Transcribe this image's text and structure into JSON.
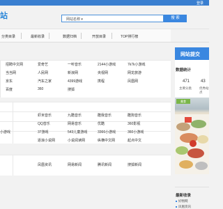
{
  "header": {
    "logo_fragment": "站",
    "login": "登录"
  },
  "search": {
    "category": "网站名称 ▾",
    "placeholder": "",
    "button": "搜 索"
  },
  "nav": {
    "items": [
      "分类目录",
      "最新收录",
      "数据归档",
      "开放目录",
      "TOP排行榜"
    ]
  },
  "links_block1": {
    "rows": [
      [
        "招聘中文网",
        "爱奇艺",
        "一听音乐",
        "2144小游戏",
        "7k7k小游戏"
      ],
      [
        "当当网",
        "人民网",
        "新浪网",
        "央视网",
        "网龙旅游"
      ],
      [
        "京东",
        "汽车之家",
        "4399游戏",
        "携程",
        "凤凰网"
      ],
      [
        "百度",
        "360",
        "搜狐",
        "",
        ""
      ]
    ]
  },
  "links_block2": {
    "rows": [
      [
        "",
        "虾米音乐",
        "九酷音乐",
        "酷我音乐",
        "酷狗音乐"
      ],
      [
        "",
        "QQ音乐",
        "网易音乐",
        "优酷",
        "360影视"
      ],
      [
        "小游戏",
        "37游戏",
        "543儿童游戏",
        "3366小游戏",
        "360小游戏"
      ],
      [
        "",
        "逐浪小说网",
        "小说阅读网",
        "纵横中文网",
        "起点中文"
      ]
    ]
  },
  "links_block3": {
    "rows": [
      [
        "",
        "凤凰资讯",
        "网易新闻",
        "腾讯新闻",
        "搜狐新闻"
      ]
    ]
  },
  "sidebar": {
    "submit_title": "网站提交",
    "stats_title": "数据统计",
    "stats": [
      {
        "value": "471",
        "label": "主要分类"
      },
      {
        "value": "43",
        "label": "优秀站点"
      }
    ],
    "photo_tag": "美食",
    "latest_title": "最新收录",
    "latest": [
      "好物网",
      "凤凰资讯",
      "搜狗搜索"
    ]
  },
  "colors": {
    "accent": "#3a87e0",
    "topbar": "#3a7fd0"
  }
}
